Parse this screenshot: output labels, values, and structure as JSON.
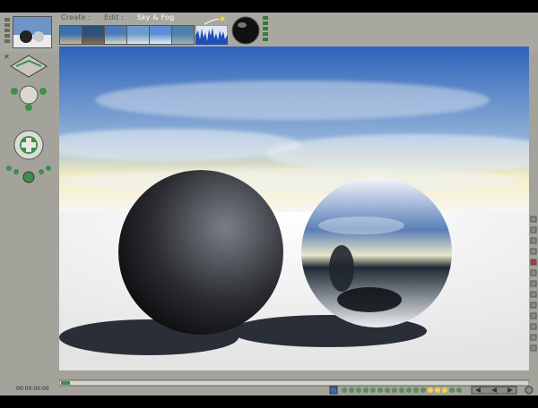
{
  "app": {
    "menu": {
      "create": "Create :",
      "edit": "Edit :",
      "active_editor": "Sky & Fog"
    },
    "timecode": "00:00:00:00"
  },
  "sky_presets": [
    {
      "name": "sky-preset-1",
      "top": "#3b6fb0",
      "bottom": "#c9b98f"
    },
    {
      "name": "sky-preset-2",
      "top": "#2d4f7a",
      "bottom": "#8a6a4a"
    },
    {
      "name": "sky-preset-3",
      "top": "#4a7bb8",
      "bottom": "#d8d8c8"
    },
    {
      "name": "sky-preset-4",
      "top": "#6d9bc9",
      "bottom": "#dfe6ea"
    },
    {
      "name": "sky-preset-5",
      "top": "#5b8fcf",
      "bottom": "#e6eef4"
    },
    {
      "name": "sky-preset-6",
      "top": "#4f7fa8",
      "bottom": "#9fb1b8"
    }
  ],
  "colors": {
    "chrome": "#a3a39b",
    "accent_green": "#3e8f4a",
    "sky_top": "#2f62b9",
    "sky_horizon": "#f4edc0"
  }
}
